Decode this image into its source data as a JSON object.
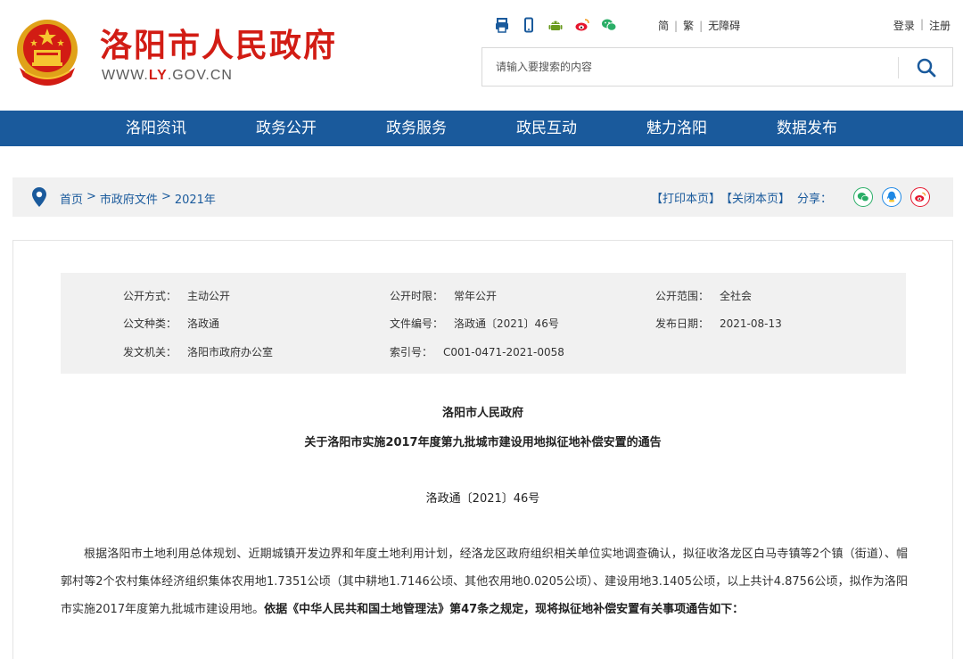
{
  "header": {
    "site_title": "洛阳市人民政府",
    "site_url_prefix": "WWW.",
    "site_url_highlight": "LY",
    "site_url_suffix": ".GOV.CN",
    "tool_icons": [
      "print-icon",
      "mobile-icon",
      "android-icon",
      "weibo-icon",
      "wechat-icon"
    ],
    "lang": {
      "simplified": "简",
      "traditional": "繁",
      "accessible": "无障碍",
      "sep": "|"
    },
    "auth": {
      "login": "登录",
      "register": "注册",
      "sep": "|"
    },
    "search": {
      "placeholder": "请输入要搜索的内容"
    },
    "colors": {
      "brand_red": "#d21c14",
      "nav_blue": "#1a5a9c"
    }
  },
  "nav": {
    "items": [
      "洛阳资讯",
      "政务公开",
      "政务服务",
      "政民互动",
      "魅力洛阳",
      "数据发布"
    ]
  },
  "breadcrumb": {
    "items": [
      "首页",
      "市政府文件",
      "2021年"
    ],
    "sep": ">"
  },
  "page_tools": {
    "print": "【打印本页】",
    "close": "【关闭本页】",
    "share": "分享："
  },
  "meta": {
    "open_method_k": "公开方式：",
    "open_method_v": "主动公开",
    "open_period_k": "公开时限：",
    "open_period_v": "常年公开",
    "open_scope_k": "公开范围：",
    "open_scope_v": "全社会",
    "doc_type_k": "公文种类：",
    "doc_type_v": "洛政通",
    "doc_no_k": "文件编号：",
    "doc_no_v": "洛政通〔2021〕46号",
    "pub_date_k": "发布日期：",
    "pub_date_v": "2021-08-13",
    "issuer_k": "发文机关：",
    "issuer_v": "洛阳市政府办公室",
    "index_k": "索引号：",
    "index_v": "C001-0471-2021-0058"
  },
  "doc": {
    "org": "洛阳市人民政府",
    "title": "关于洛阳市实施2017年度第九批城市建设用地拟征地补偿安置的通告",
    "number": "洛政通〔2021〕46号",
    "body_1": "根据洛阳市土地利用总体规划、近期城镇开发边界和年度土地利用计划，经洛龙区政府组织相关单位实地调查确认，拟征收洛龙区白马寺镇等2个镇（街道）、帽郭村等2个农村集体经济组织集体农用地1.7351公顷（其中耕地1.7146公顷、其他农用地0.0205公顷）、建设用地3.1405公顷，以上共计4.8756公顷，拟作为洛阳市实施2017年度第九批城市建设用地。",
    "body_2": "依据《中华人民共和国土地管理法》第47条之规定，现将拟征地补偿安置有关事项通告如下："
  }
}
